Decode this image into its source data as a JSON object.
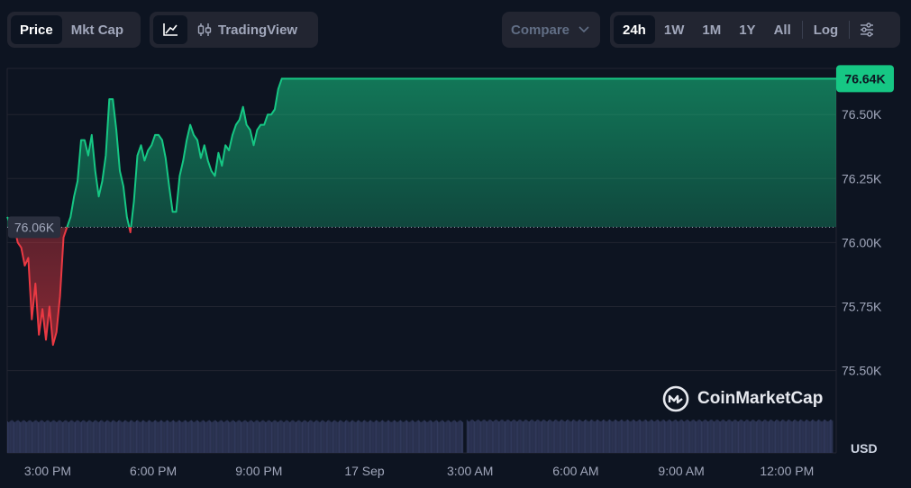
{
  "toolbar": {
    "price_label": "Price",
    "mktcap_label": "Mkt Cap",
    "tradingview_label": "TradingView",
    "compare_label": "Compare",
    "ranges": [
      "24h",
      "1W",
      "1M",
      "1Y",
      "All"
    ],
    "log_label": "Log"
  },
  "watermark": {
    "brand": "CoinMarketCap"
  },
  "currency_label": "USD",
  "colors": {
    "up": "#16c784",
    "down": "#ea3943",
    "background": "#0d1421",
    "grid": "#222531",
    "volume": "#323a5c"
  },
  "chart_data": {
    "type": "area",
    "x_ticks": [
      "3:00 PM",
      "6:00 PM",
      "9:00 PM",
      "17 Sep",
      "3:00 AM",
      "6:00 AM",
      "9:00 AM",
      "12:00 PM"
    ],
    "y_ticks": [
      "76.50K",
      "76.25K",
      "76.00K",
      "75.75K",
      "75.50K"
    ],
    "ylim": [
      75.4,
      76.68
    ],
    "xlim": [
      13.85,
      37.4
    ],
    "baseline": 76.06,
    "baseline_label": "76.06K",
    "current_label": "76.64K",
    "x": [
      13.85,
      13.95,
      14.05,
      14.15,
      14.25,
      14.35,
      14.45,
      14.55,
      14.65,
      14.75,
      14.85,
      14.95,
      15.05,
      15.15,
      15.25,
      15.35,
      15.45,
      15.55,
      15.65,
      15.75,
      15.85,
      15.95,
      16.05,
      16.15,
      16.25,
      16.35,
      16.45,
      16.55,
      16.65,
      16.75,
      16.85,
      16.95,
      17.05,
      17.15,
      17.25,
      17.35,
      17.45,
      17.55,
      17.65,
      17.75,
      17.85,
      17.95,
      18.05,
      18.15,
      18.25,
      18.35,
      18.45,
      18.55,
      18.65,
      18.75,
      18.85,
      18.95,
      19.05,
      19.15,
      19.25,
      19.35,
      19.45,
      19.55,
      19.65,
      19.75,
      19.85,
      19.95,
      20.05,
      20.15,
      20.25,
      20.35,
      20.45,
      20.55,
      20.65,
      20.75,
      20.85,
      20.95,
      21.05,
      21.15,
      21.25,
      21.35,
      21.45,
      21.55,
      21.65,
      21.75,
      21.85,
      21.95,
      22.05,
      22.15,
      22.25,
      22.35,
      22.45,
      22.55,
      22.65,
      22.75,
      22.85,
      22.95,
      23.05,
      23.15,
      23.25,
      23.35,
      23.45,
      23.55,
      23.65,
      23.75,
      23.85,
      23.95,
      24.05,
      24.15,
      24.25,
      24.35,
      24.45,
      24.55,
      24.65,
      24.75,
      24.85,
      24.95,
      25.05,
      25.15,
      25.25,
      25.35,
      25.45,
      25.55,
      25.65,
      25.75,
      25.85,
      25.95,
      26.05,
      26.15,
      26.25,
      26.35,
      26.45,
      26.55,
      26.65,
      26.75,
      26.8,
      37.4
    ],
    "values": [
      76.1,
      76.07,
      76.06,
      76.0,
      75.98,
      75.91,
      75.94,
      75.7,
      75.84,
      75.64,
      75.74,
      75.62,
      75.75,
      75.6,
      75.65,
      75.79,
      76.02,
      76.06,
      76.1,
      76.18,
      76.24,
      76.4,
      76.4,
      76.34,
      76.42,
      76.28,
      76.18,
      76.24,
      76.34,
      76.56,
      76.56,
      76.44,
      76.28,
      76.22,
      76.1,
      76.04,
      76.16,
      76.34,
      76.38,
      76.32,
      76.36,
      76.38,
      76.42,
      76.42,
      76.4,
      76.33,
      76.22,
      76.12,
      76.12,
      76.26,
      76.32,
      76.4,
      76.46,
      76.42,
      76.4,
      76.33,
      76.38,
      76.32,
      76.28,
      76.26,
      76.35,
      76.3,
      76.38,
      76.36,
      76.42,
      76.46,
      76.48,
      76.53,
      76.46,
      76.44,
      76.38,
      76.44,
      76.46,
      76.46,
      76.5,
      76.5,
      76.52,
      76.6,
      76.64,
      76.64,
      76.64,
      76.64,
      76.64,
      76.64,
      76.64,
      76.64,
      76.64,
      76.64,
      76.64,
      76.64,
      76.64,
      76.64,
      76.64,
      76.64,
      76.64,
      76.64,
      76.64,
      76.64,
      76.64,
      76.64,
      76.64,
      76.64,
      76.64,
      76.64,
      76.64,
      76.64,
      76.64,
      76.64,
      76.64,
      76.64,
      76.64,
      76.64,
      76.64,
      76.64,
      76.64,
      76.64,
      76.64,
      76.64,
      76.64,
      76.64,
      76.64,
      76.64,
      76.64,
      76.64,
      76.64,
      76.64,
      76.64,
      76.64,
      76.64,
      76.64,
      76.64,
      76.64
    ],
    "volume_x": [
      13.85,
      26.8,
      26.9,
      37.3
    ],
    "volume": [
      0.55,
      0.55,
      0.56,
      0.56
    ]
  }
}
